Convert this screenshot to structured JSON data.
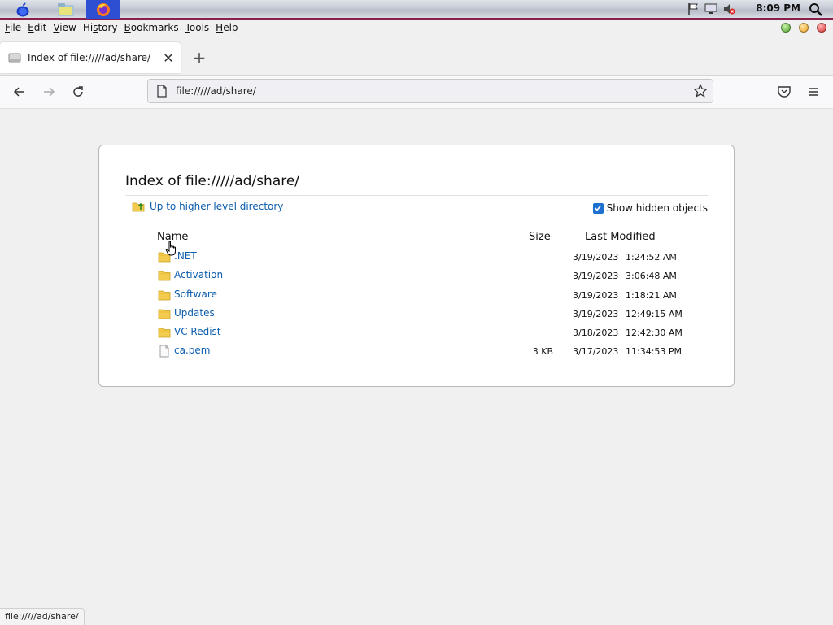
{
  "system": {
    "clock": "8:09 PM",
    "accent_color": "#8a1f4a"
  },
  "menubar": {
    "items": [
      {
        "pre": "",
        "u": "F",
        "post": "ile"
      },
      {
        "pre": "",
        "u": "E",
        "post": "dit"
      },
      {
        "pre": "",
        "u": "V",
        "post": "iew"
      },
      {
        "pre": "Hi",
        "u": "s",
        "post": "tory"
      },
      {
        "pre": "",
        "u": "B",
        "post": "ookmarks"
      },
      {
        "pre": "",
        "u": "T",
        "post": "ools"
      },
      {
        "pre": "",
        "u": "H",
        "post": "elp"
      }
    ]
  },
  "tab": {
    "title": "Index of file://///ad/share/",
    "close_glyph": "✕",
    "new_tab_glyph": "+"
  },
  "urlbar": {
    "value": "file://///ad/share/"
  },
  "listing": {
    "title": "Index of file://///ad/share/",
    "up_link": "Up to higher level directory",
    "show_hidden_label": "Show hidden objects",
    "show_hidden_checked": true,
    "columns": {
      "name": "Name",
      "size": "Size",
      "modified": "Last Modified"
    },
    "rows": [
      {
        "name": ".NET",
        "type": "folder",
        "size": "",
        "date": "3/19/2023",
        "time": "1:24:52 AM"
      },
      {
        "name": "Activation",
        "type": "folder",
        "size": "",
        "date": "3/19/2023",
        "time": "3:06:48 AM"
      },
      {
        "name": "Software",
        "type": "folder",
        "size": "",
        "date": "3/19/2023",
        "time": "1:18:21 AM"
      },
      {
        "name": "Updates",
        "type": "folder",
        "size": "",
        "date": "3/19/2023",
        "time": "12:49:15 AM"
      },
      {
        "name": "VC Redist",
        "type": "folder",
        "size": "",
        "date": "3/18/2023",
        "time": "12:42:30 AM"
      },
      {
        "name": "ca.pem",
        "type": "file",
        "size": "3 KB",
        "date": "3/17/2023",
        "time": "11:34:53 PM"
      }
    ],
    "link_color": "#0b5cad"
  },
  "status": {
    "text": "file://///ad/share/"
  }
}
